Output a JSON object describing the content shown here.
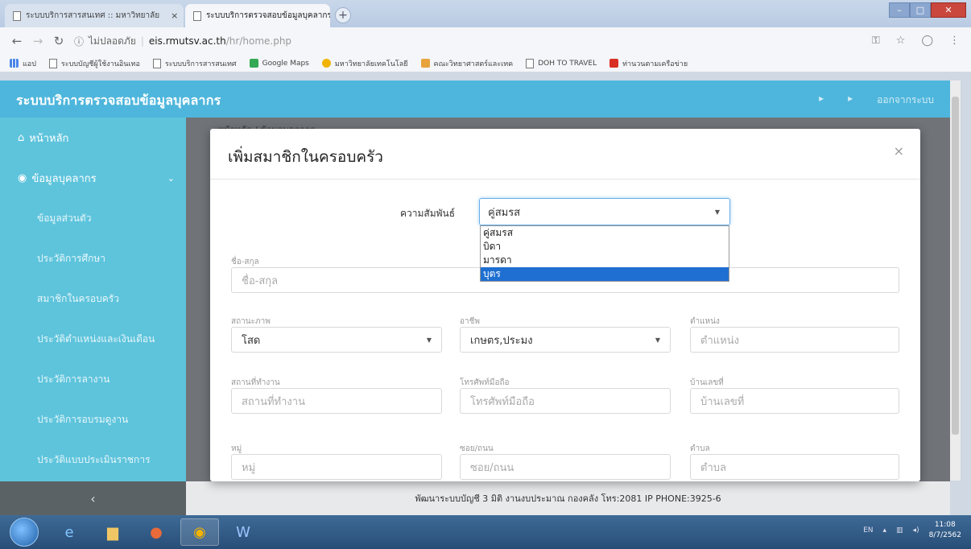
{
  "browser": {
    "tabs": [
      {
        "label": "ระบบบริการสารสนเทศ :: มหาวิทยาลัย",
        "close": "×"
      },
      {
        "label": "ระบบบริการตรวจสอบข้อมูลบุคลากร",
        "close": "×"
      }
    ],
    "new_tab": "+",
    "window_controls": {
      "minimize": "–",
      "maximize": "□",
      "close": "✕"
    },
    "security_label": "ไม่ปลอดภัย",
    "url_host": "eis.rmutsv.ac.th",
    "url_path": "/hr/home.php",
    "bookmarks": [
      "แอป",
      "ระบบบัญชีผู้ใช้งานอินเทอ",
      "ระบบบริการสารสนเทศ",
      "Google Maps",
      "มหาวิทยาลัยเทคโนโลยี",
      "คณะวิทยาศาสตร์และเทค",
      "DOH TO TRAVEL",
      "ท่านวนตามเครือข่าย"
    ]
  },
  "app": {
    "title": "ระบบบริการตรวจสอบข้อมูลบุคลากร",
    "header_right": [
      "▸",
      "▸",
      "ออกจากระบบ"
    ],
    "breadcrumb": "หน้าหลัก / ข้อมูลบุคลากร",
    "footer": "พัฒนาระบบบัญชี 3 มิติ งานงบประมาณ กองคลัง โทร:2081 IP PHONE:3925-6",
    "sidebar_collapse": "‹"
  },
  "sidebar": {
    "items": [
      {
        "label": "หน้าหลัก"
      },
      {
        "label": "ข้อมูลบุคลากร"
      },
      {
        "label": "ข้อมูลส่วนตัว"
      },
      {
        "label": "ประวัติการศึกษา"
      },
      {
        "label": "สมาชิกในครอบครัว"
      },
      {
        "label": "ประวัติตำแหน่งและเงินเดือน"
      },
      {
        "label": "ประวัติการลางาน"
      },
      {
        "label": "ประวัติการอบรมดูงาน"
      },
      {
        "label": "ประวัติแบบประเมินราชการ"
      }
    ]
  },
  "modal": {
    "title": "เพิ่มสมาชิกในครอบครัว",
    "close": "×",
    "relation_label": "ความสัมพันธ์",
    "relation_value": "คู่สมรส",
    "relation_options": [
      "คู่สมรส",
      "บิดา",
      "มารดา",
      "บุตร"
    ],
    "fields": {
      "name": {
        "label": "ชื่อ-สกุล",
        "placeholder": "ชื่อ-สกุล"
      },
      "marital": {
        "label": "สถานะภาพ",
        "value": "โสด"
      },
      "occupation": {
        "label": "อาชีพ",
        "value": "เกษตร,ประมง"
      },
      "position": {
        "label": "ตำแหน่ง",
        "placeholder": "ตำแหน่ง"
      },
      "workplace": {
        "label": "สถานที่ทำงาน",
        "placeholder": "สถานที่ทำงาน"
      },
      "mobile": {
        "label": "โทรศัพท์มือถือ",
        "placeholder": "โทรศัพท์มือถือ"
      },
      "house_no": {
        "label": "บ้านเลขที่",
        "placeholder": "บ้านเลขที่"
      },
      "moo": {
        "label": "หมู่",
        "placeholder": "หมู่"
      },
      "soi": {
        "label": "ซอย/ถนน",
        "placeholder": "ซอย/ถนน"
      },
      "tambon": {
        "label": "ตำบล",
        "placeholder": "ตำบล"
      }
    }
  },
  "taskbar": {
    "lang": "EN",
    "time": "11:08",
    "date": "8/7/2562"
  }
}
